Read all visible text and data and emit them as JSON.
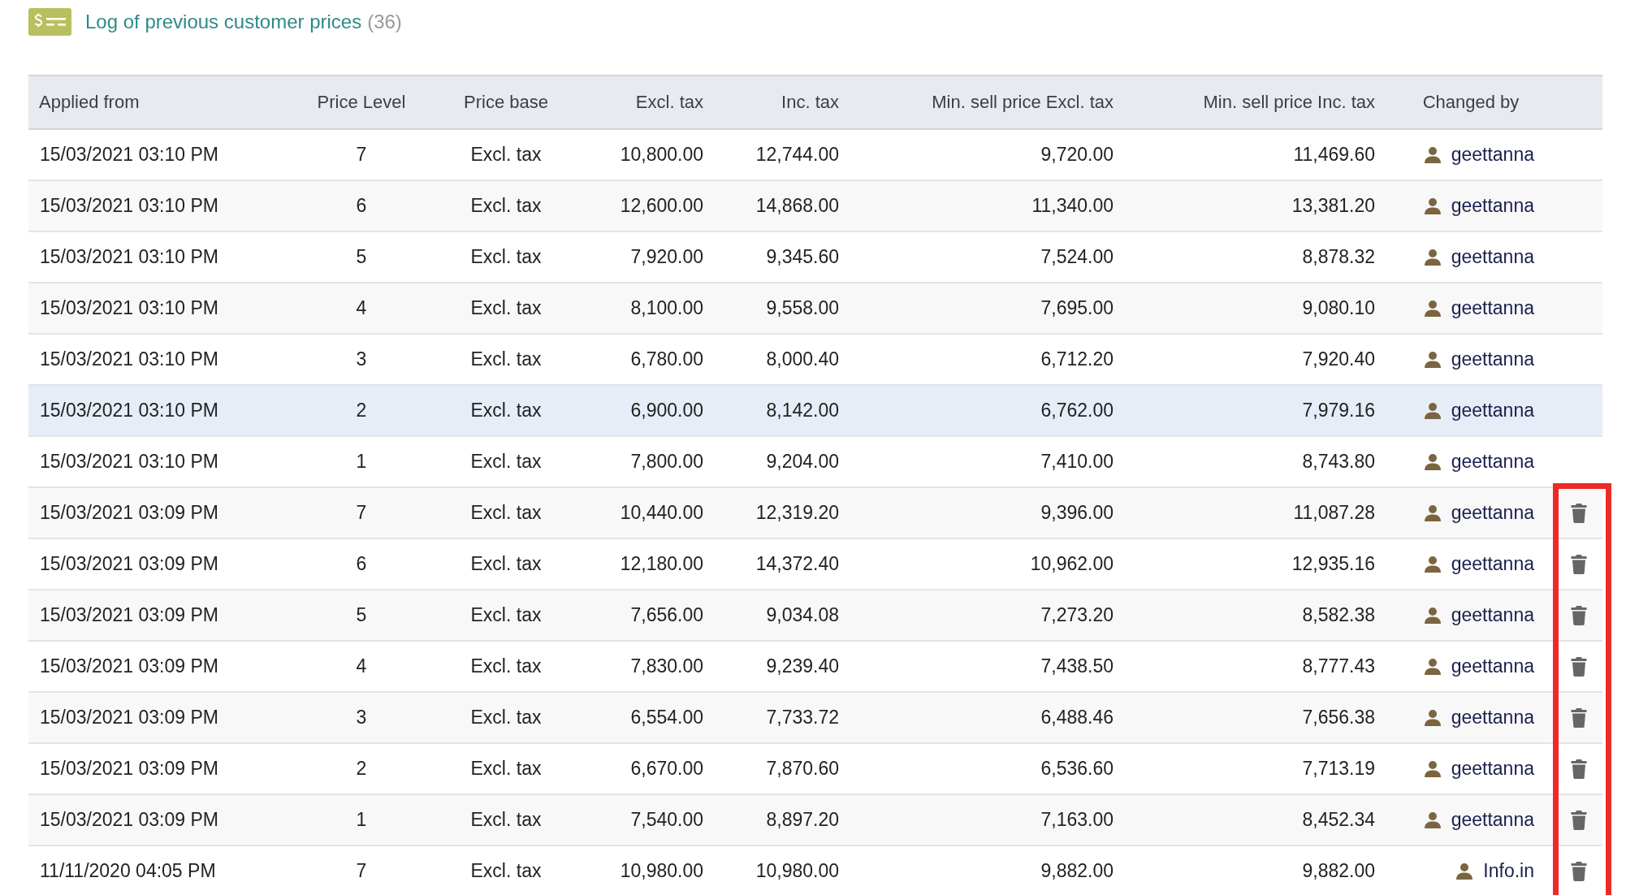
{
  "header": {
    "title": "Log of previous customer prices",
    "count": "(36)"
  },
  "table": {
    "columns": [
      "Applied from",
      "Price Level",
      "Price base",
      "Excl. tax",
      "Inc. tax",
      "Min. sell price Excl. tax",
      "Min. sell price Inc. tax",
      "Changed by"
    ],
    "rows": [
      {
        "cells": [
          "15/03/2021 03:10 PM",
          "7",
          "Excl. tax",
          "10,800.00",
          "12,744.00",
          "9,720.00",
          "11,469.60"
        ],
        "changed_by": "geettanna",
        "selected": false,
        "deletable": false
      },
      {
        "cells": [
          "15/03/2021 03:10 PM",
          "6",
          "Excl. tax",
          "12,600.00",
          "14,868.00",
          "11,340.00",
          "13,381.20"
        ],
        "changed_by": "geettanna",
        "selected": false,
        "deletable": false
      },
      {
        "cells": [
          "15/03/2021 03:10 PM",
          "5",
          "Excl. tax",
          "7,920.00",
          "9,345.60",
          "7,524.00",
          "8,878.32"
        ],
        "changed_by": "geettanna",
        "selected": false,
        "deletable": false
      },
      {
        "cells": [
          "15/03/2021 03:10 PM",
          "4",
          "Excl. tax",
          "8,100.00",
          "9,558.00",
          "7,695.00",
          "9,080.10"
        ],
        "changed_by": "geettanna",
        "selected": false,
        "deletable": false
      },
      {
        "cells": [
          "15/03/2021 03:10 PM",
          "3",
          "Excl. tax",
          "6,780.00",
          "8,000.40",
          "6,712.20",
          "7,920.40"
        ],
        "changed_by": "geettanna",
        "selected": false,
        "deletable": false
      },
      {
        "cells": [
          "15/03/2021 03:10 PM",
          "2",
          "Excl. tax",
          "6,900.00",
          "8,142.00",
          "6,762.00",
          "7,979.16"
        ],
        "changed_by": "geettanna",
        "selected": true,
        "deletable": false
      },
      {
        "cells": [
          "15/03/2021 03:10 PM",
          "1",
          "Excl. tax",
          "7,800.00",
          "9,204.00",
          "7,410.00",
          "8,743.80"
        ],
        "changed_by": "geettanna",
        "selected": false,
        "deletable": false
      },
      {
        "cells": [
          "15/03/2021 03:09 PM",
          "7",
          "Excl. tax",
          "10,440.00",
          "12,319.20",
          "9,396.00",
          "11,087.28"
        ],
        "changed_by": "geettanna",
        "selected": false,
        "deletable": true
      },
      {
        "cells": [
          "15/03/2021 03:09 PM",
          "6",
          "Excl. tax",
          "12,180.00",
          "14,372.40",
          "10,962.00",
          "12,935.16"
        ],
        "changed_by": "geettanna",
        "selected": false,
        "deletable": true
      },
      {
        "cells": [
          "15/03/2021 03:09 PM",
          "5",
          "Excl. tax",
          "7,656.00",
          "9,034.08",
          "7,273.20",
          "8,582.38"
        ],
        "changed_by": "geettanna",
        "selected": false,
        "deletable": true
      },
      {
        "cells": [
          "15/03/2021 03:09 PM",
          "4",
          "Excl. tax",
          "7,830.00",
          "9,239.40",
          "7,438.50",
          "8,777.43"
        ],
        "changed_by": "geettanna",
        "selected": false,
        "deletable": true
      },
      {
        "cells": [
          "15/03/2021 03:09 PM",
          "3",
          "Excl. tax",
          "6,554.00",
          "7,733.72",
          "6,488.46",
          "7,656.38"
        ],
        "changed_by": "geettanna",
        "selected": false,
        "deletable": true
      },
      {
        "cells": [
          "15/03/2021 03:09 PM",
          "2",
          "Excl. tax",
          "6,670.00",
          "7,870.60",
          "6,536.60",
          "7,713.19"
        ],
        "changed_by": "geettanna",
        "selected": false,
        "deletable": true
      },
      {
        "cells": [
          "15/03/2021 03:09 PM",
          "1",
          "Excl. tax",
          "7,540.00",
          "8,897.20",
          "7,163.00",
          "8,452.34"
        ],
        "changed_by": "geettanna",
        "selected": false,
        "deletable": true
      },
      {
        "cells": [
          "11/11/2020 04:05 PM",
          "7",
          "Excl. tax",
          "10,980.00",
          "10,980.00",
          "9,882.00",
          "9,882.00"
        ],
        "changed_by": "Info.in",
        "selected": false,
        "deletable": true
      }
    ]
  }
}
